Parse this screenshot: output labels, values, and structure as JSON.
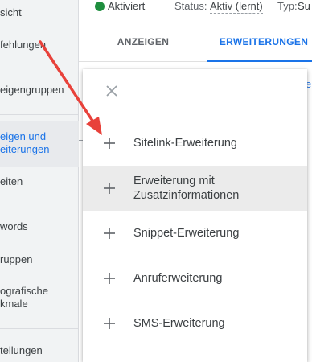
{
  "sidebar": {
    "items": [
      {
        "label": "sicht"
      },
      {
        "label": "fehlungen"
      },
      {
        "label": "eigengruppen"
      },
      {
        "label_line1": "eigen und",
        "label_line2": "eiterungen"
      },
      {
        "label": "eiten"
      },
      {
        "label": "words"
      },
      {
        "label": "ruppen"
      },
      {
        "label_line1": "ografische",
        "label_line2": "kmale"
      },
      {
        "label": "tellungen"
      }
    ]
  },
  "topbar": {
    "active_label": "Aktiviert",
    "status_label": "Status:",
    "status_value": "Aktiv (lernt)",
    "type_label": "Typ:",
    "type_value": "Su"
  },
  "tabs": {
    "anzeigen": "ANZEIGEN",
    "erweiterungen": "ERWEITERUNGEN"
  },
  "background": {
    "link_fragment": "e"
  },
  "menu": {
    "items": [
      {
        "label": "Sitelink-Erweiterung"
      },
      {
        "label_line1": "Erweiterung mit",
        "label_line2": "Zusatzinformationen"
      },
      {
        "label": "Snippet-Erweiterung"
      },
      {
        "label": "Anruferweiterung"
      },
      {
        "label": "SMS-Erweiterung"
      }
    ]
  },
  "colors": {
    "accent": "#1a73e8",
    "status_green": "#1e8e3e",
    "annotation_arrow": "#e8413a",
    "hover_row": "#ebebeb"
  },
  "icons": {
    "close": "close-icon",
    "add": "plus-icon",
    "status": "status-dot-icon"
  }
}
